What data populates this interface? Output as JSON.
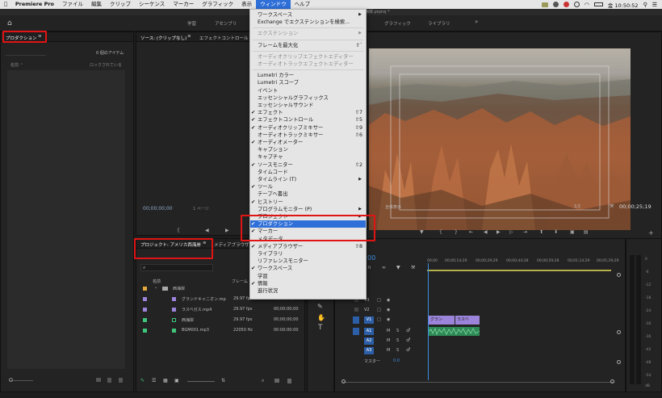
{
  "menubar": {
    "items": [
      "Premiere Pro",
      "ファイル",
      "編集",
      "クリップ",
      "シーケンス",
      "マーカー",
      "グラフィック",
      "表示",
      "ウィンドウ",
      "ヘルプ"
    ],
    "active_item": "ウィンドウ",
    "clock": "金 10:50:52"
  },
  "titlebar": {
    "title": "西海岸.prproj *"
  },
  "workspaces": {
    "items": [
      "学習",
      "アセンブリ",
      "グラフィック",
      "ライブラリ"
    ],
    "more": "»"
  },
  "project_panel": {
    "title": "プロダクション",
    "item_count": "0 個のアイテム",
    "col_name": "名前 ⌃",
    "col_lock": "ロックされている"
  },
  "source_panel": {
    "tabs": [
      "ソース: (クリップなし)",
      "エフェクトコントロール"
    ],
    "timecode": "00;00;00;00",
    "page": "1 ページ"
  },
  "program_panel": {
    "fit": "全体表示",
    "scale": "1/2",
    "duration": "00;00;25;19"
  },
  "project_bin": {
    "tabs": [
      "プロジェクト: アメリカ西海岸",
      "メディアブラウザー"
    ],
    "col_name": "名前",
    "col_framerate": "フレーム",
    "folder": "西海岸",
    "files": [
      {
        "name": "グランドキャニオン.mp",
        "rate": "29.97 fps",
        "tc": "00;00;00;00",
        "color": "#9b84d9"
      },
      {
        "name": "ラスベガス.mp4",
        "rate": "29.97 fps",
        "tc": "00;00;00;00",
        "color": "#9b84d9"
      },
      {
        "name": "西海岸",
        "rate": "29.97 fps",
        "tc": "00;00;00;00",
        "color": "#3ec47b"
      },
      {
        "name": "BGM001.mp3",
        "rate": "22050 Hz",
        "tc": "00:00:00:00",
        "color": "#3ec47b"
      }
    ]
  },
  "timeline": {
    "timecode": "00",
    "ruler": [
      "00;00",
      "00;00;14;29",
      "00;00;29;29",
      "00;00;44;28",
      "00;00;59;28",
      "00;01;14;29",
      "00;01;29;29",
      "00;01;44;3"
    ],
    "video_tracks": [
      "V3",
      "V2",
      "V1"
    ],
    "audio_tracks": [
      "A1",
      "A2",
      "A3"
    ],
    "master_label": "マスター",
    "master_value": "0.0",
    "clips": [
      "グラン",
      "ラスベ"
    ],
    "meter_scale": [
      "0",
      "-6",
      "-12",
      "-18",
      "-24",
      "-30",
      "-36",
      "-42",
      "-48",
      "-54"
    ],
    "meter_unit": "dB"
  },
  "window_menu": {
    "items": [
      {
        "label": "ワークスペース",
        "sub": true
      },
      {
        "label": "Exchange でエクステンションを検索..."
      },
      {
        "sep": true
      },
      {
        "label": "エクステンション",
        "sub": true,
        "disabled": true
      },
      {
        "sep": true
      },
      {
        "label": "フレームを最大化",
        "sc": "⇧`"
      },
      {
        "sep": true
      },
      {
        "label": "オーディオクリップエフェクトエディター",
        "disabled": true
      },
      {
        "label": "オーディオトラックエフェクトエディター",
        "disabled": true
      },
      {
        "sep": true
      },
      {
        "label": "Lumetri カラー"
      },
      {
        "label": "Lumetri スコープ"
      },
      {
        "label": "イベント"
      },
      {
        "label": "エッセンシャルグラフィックス"
      },
      {
        "label": "エッセンシャルサウンド"
      },
      {
        "label": "エフェクト",
        "check": true,
        "sc": "⇧7"
      },
      {
        "label": "エフェクトコントロール",
        "check": true,
        "sc": "⇧5"
      },
      {
        "label": "オーディオクリップミキサー",
        "check": true,
        "sc": "⇧9"
      },
      {
        "label": "オーディオトラックミキサー",
        "sc": "⇧6"
      },
      {
        "label": "オーディオメーター",
        "check": true
      },
      {
        "label": "キャプション"
      },
      {
        "label": "キャプチャ"
      },
      {
        "label": "ソースモニター",
        "check": true,
        "sc": "⇧2"
      },
      {
        "label": "タイムコード"
      },
      {
        "label": "タイムライン (T)",
        "sub": true
      },
      {
        "label": "ツール",
        "check": true
      },
      {
        "label": "テープへ書出"
      },
      {
        "label": "ヒストリー",
        "check": true
      },
      {
        "label": "プログラムモニター (P)",
        "sub": true
      },
      {
        "label": "プロジェクト",
        "sub": true
      },
      {
        "label": "プロダクション",
        "check": true,
        "highlight": true
      },
      {
        "label": "マーカー",
        "check": true
      },
      {
        "label": "メタデータ"
      },
      {
        "label": "メディアブラウザー",
        "check": true,
        "sc": "⇧8"
      },
      {
        "label": "ライブラリ"
      },
      {
        "label": "リファレンスモニター"
      },
      {
        "label": "ワークスペース",
        "check": true
      },
      {
        "label": "学習"
      },
      {
        "label": "情報",
        "check": true
      },
      {
        "label": "進行状況"
      }
    ]
  }
}
